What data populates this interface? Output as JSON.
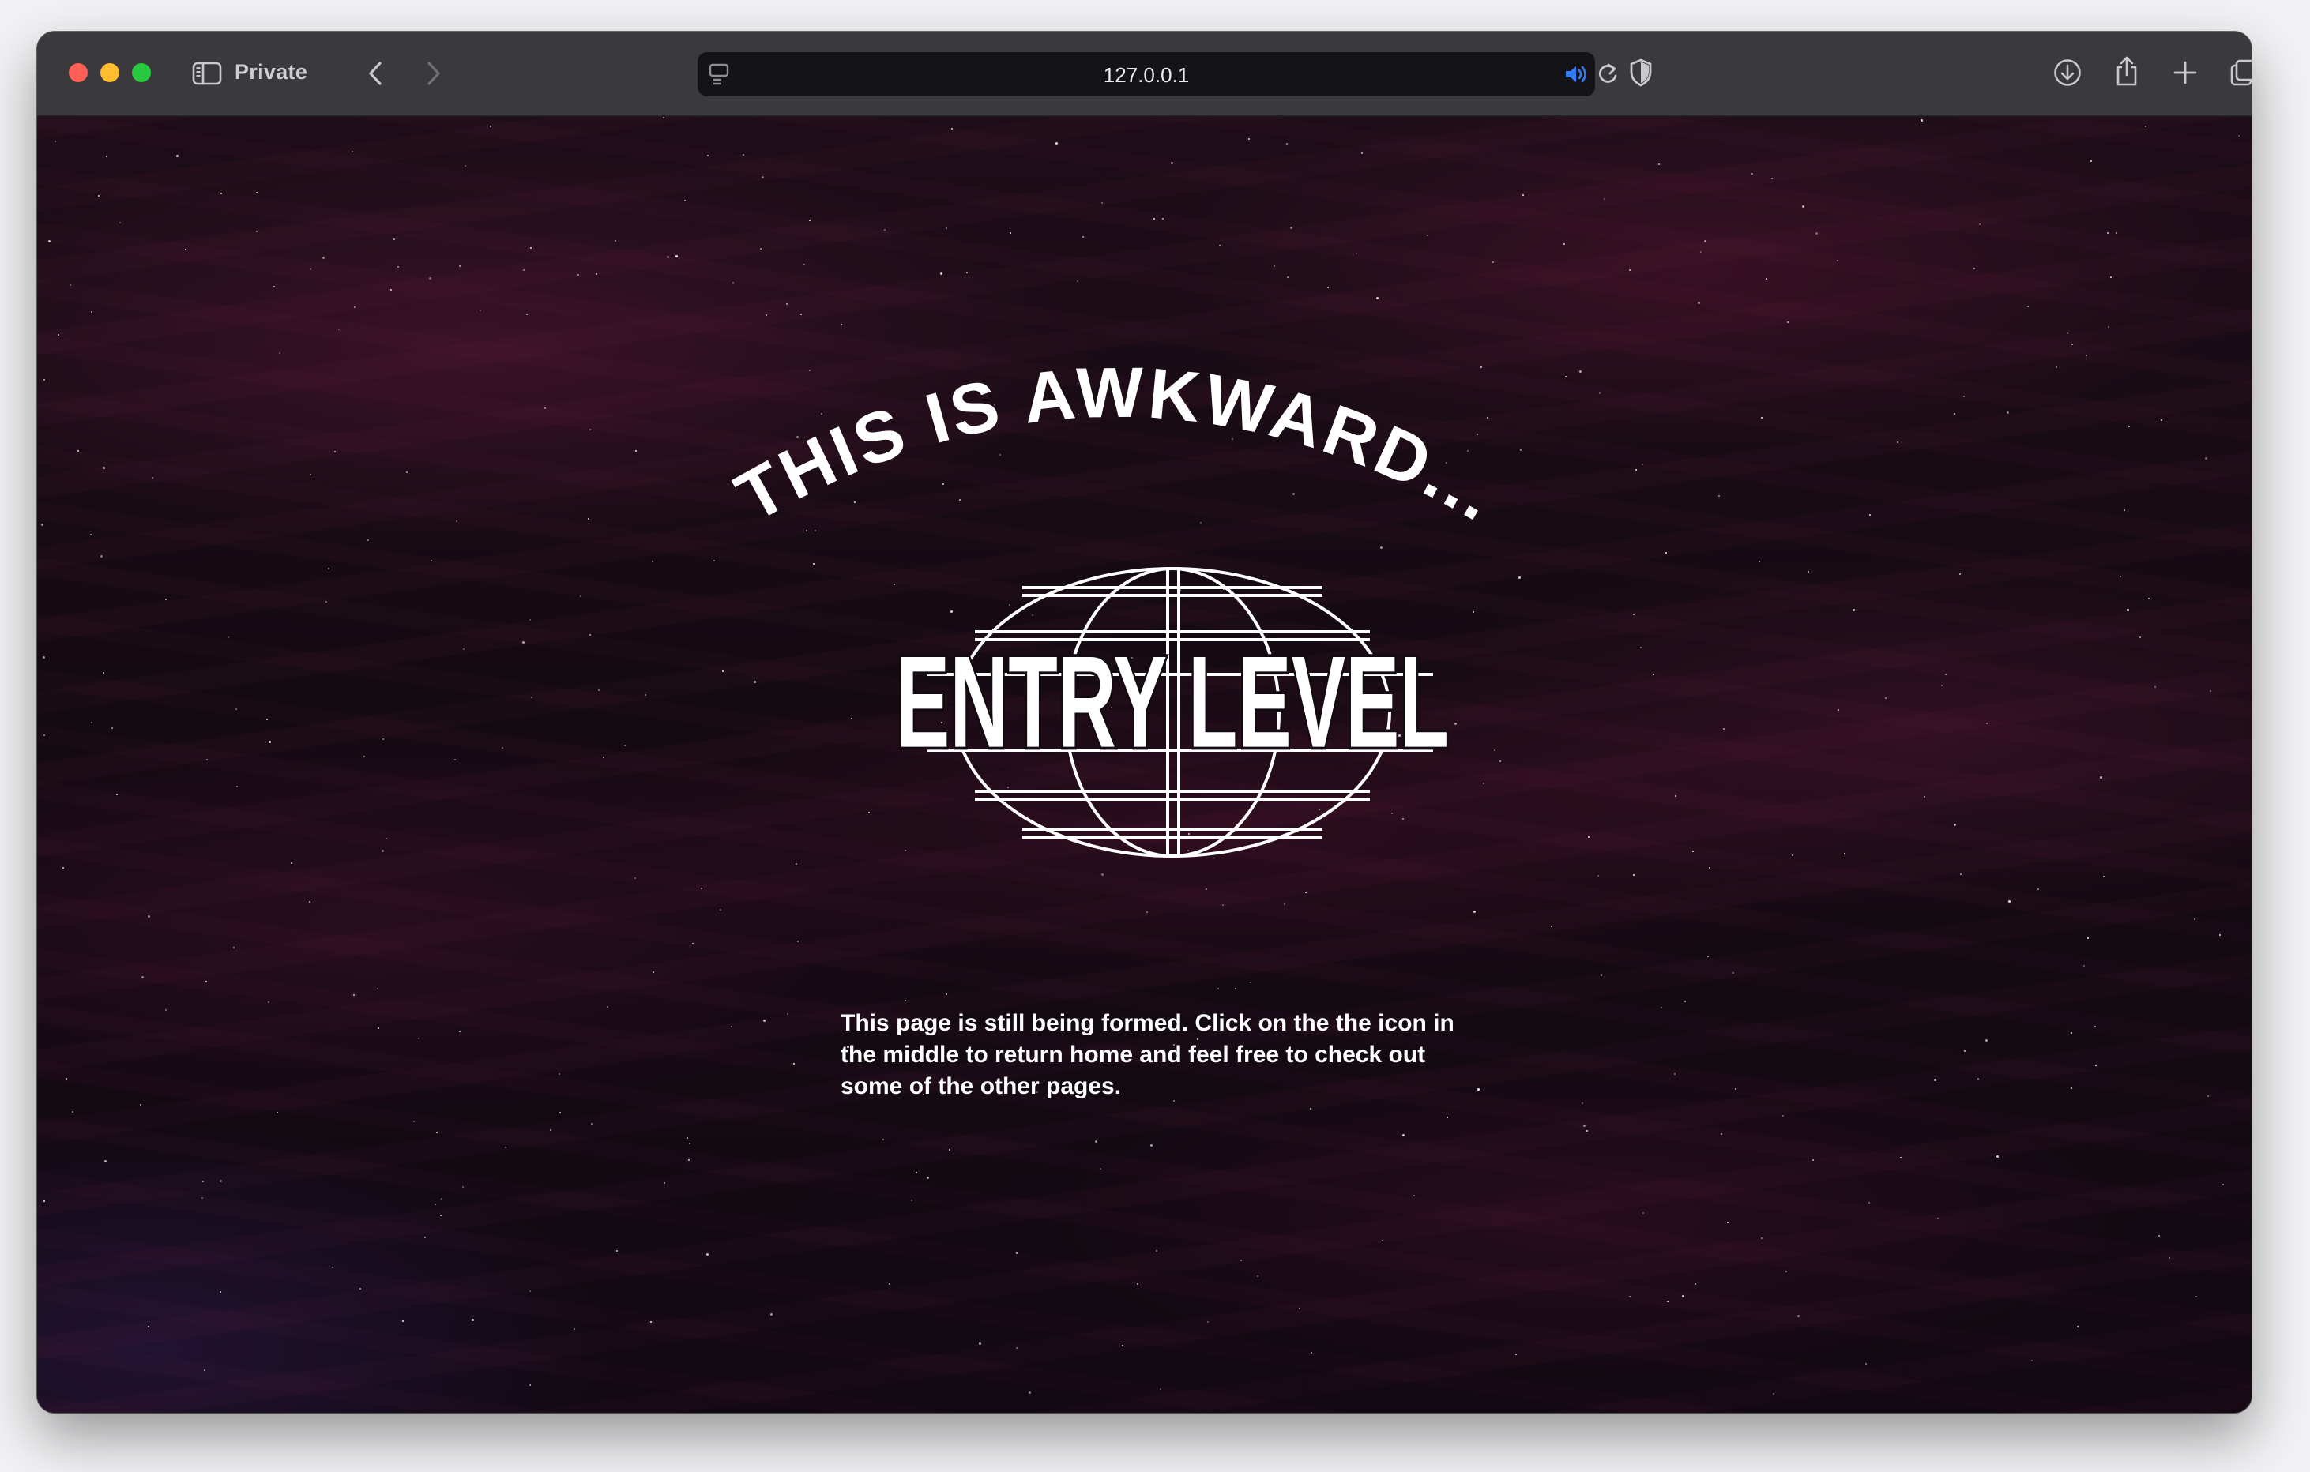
{
  "browser": {
    "mode_label": "Private",
    "url": "127.0.0.1",
    "icons": {
      "close": "close-traffic-light",
      "minimize": "minimize-traffic-light",
      "zoom": "zoom-traffic-light",
      "sidebar": "sidebar-icon",
      "back": "chevron-left-icon",
      "forward": "chevron-right-icon",
      "site_settings": "page-settings-icon",
      "audio": "speaker-icon",
      "reload": "reload-icon",
      "privacy": "shield-icon",
      "downloads": "download-icon",
      "share": "share-icon",
      "new_tab": "plus-icon",
      "tabs": "tab-overview-icon"
    },
    "colors": {
      "close": "#ff5f57",
      "minimize": "#febc2e",
      "zoom": "#28c840",
      "audio": "#2f7df6"
    }
  },
  "page": {
    "headline": "THIS IS AWKWARD...",
    "logo_text": "ENTRY LEVEL",
    "message": "This page is still being formed. Click on the the icon in the middle to return home and feel free to check out some of the other pages."
  }
}
